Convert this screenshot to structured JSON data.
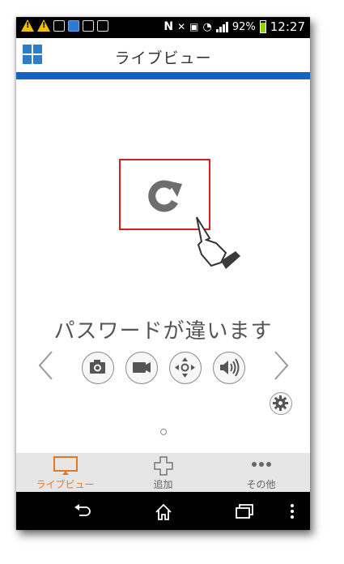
{
  "status_bar": {
    "battery": "92%",
    "time": "12:27"
  },
  "header": {
    "title": "ライブビュー"
  },
  "main": {
    "message": "パスワードが違います"
  },
  "tabs": [
    {
      "label": "ライブビュー",
      "icon": "monitor-icon",
      "active": true
    },
    {
      "label": "追加",
      "icon": "plus-icon",
      "active": false
    },
    {
      "label": "その他",
      "icon": "more-dots-icon",
      "active": false
    }
  ],
  "controls": [
    "camera-snapshot-icon",
    "video-record-icon",
    "ptz-direction-icon",
    "speaker-icon"
  ],
  "colors": {
    "accent_blue": "#1565c0",
    "active_tab": "#e87722",
    "highlight_box": "#d32020"
  }
}
